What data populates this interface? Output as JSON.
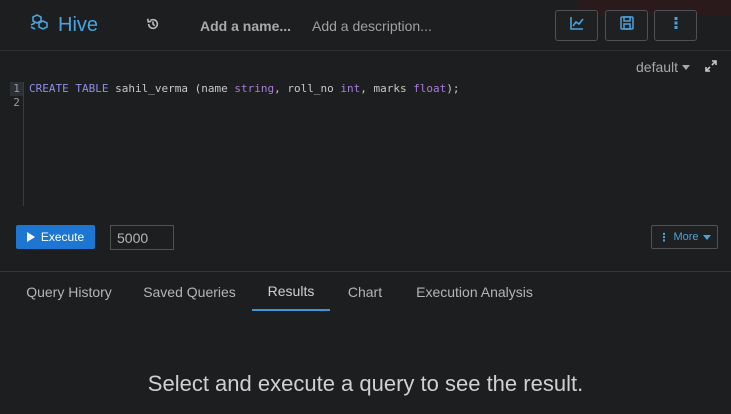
{
  "app": {
    "name": "Hive"
  },
  "header": {
    "name_placeholder": "Add a name...",
    "description_placeholder": "Add a description...",
    "icons": [
      "hive-logo-icon",
      "history-icon",
      "chart-icon",
      "save-icon",
      "more-vertical-icon"
    ]
  },
  "editor": {
    "database": "default",
    "line_numbers": [
      "1",
      "2"
    ],
    "code": {
      "kw1": "CREATE",
      "kw2": "TABLE",
      "t1": " sahil_verma (name ",
      "ty1": "string",
      "t2": ", roll_no ",
      "ty2": "int",
      "t3": ", marks ",
      "ty3": "float",
      "t4": ");"
    }
  },
  "toolbar": {
    "execute_label": "Execute",
    "limit_value": "5000",
    "more_label": "More"
  },
  "tabs": [
    {
      "label": "Query History"
    },
    {
      "label": "Saved Queries"
    },
    {
      "label": "Results",
      "active": true
    },
    {
      "label": "Chart"
    },
    {
      "label": "Execution Analysis"
    }
  ],
  "results": {
    "empty_message": "Select and execute a query to see the result."
  },
  "colors": {
    "accent": "#4aa3df",
    "execute": "#1c76d2",
    "background": "#1c1e20"
  }
}
